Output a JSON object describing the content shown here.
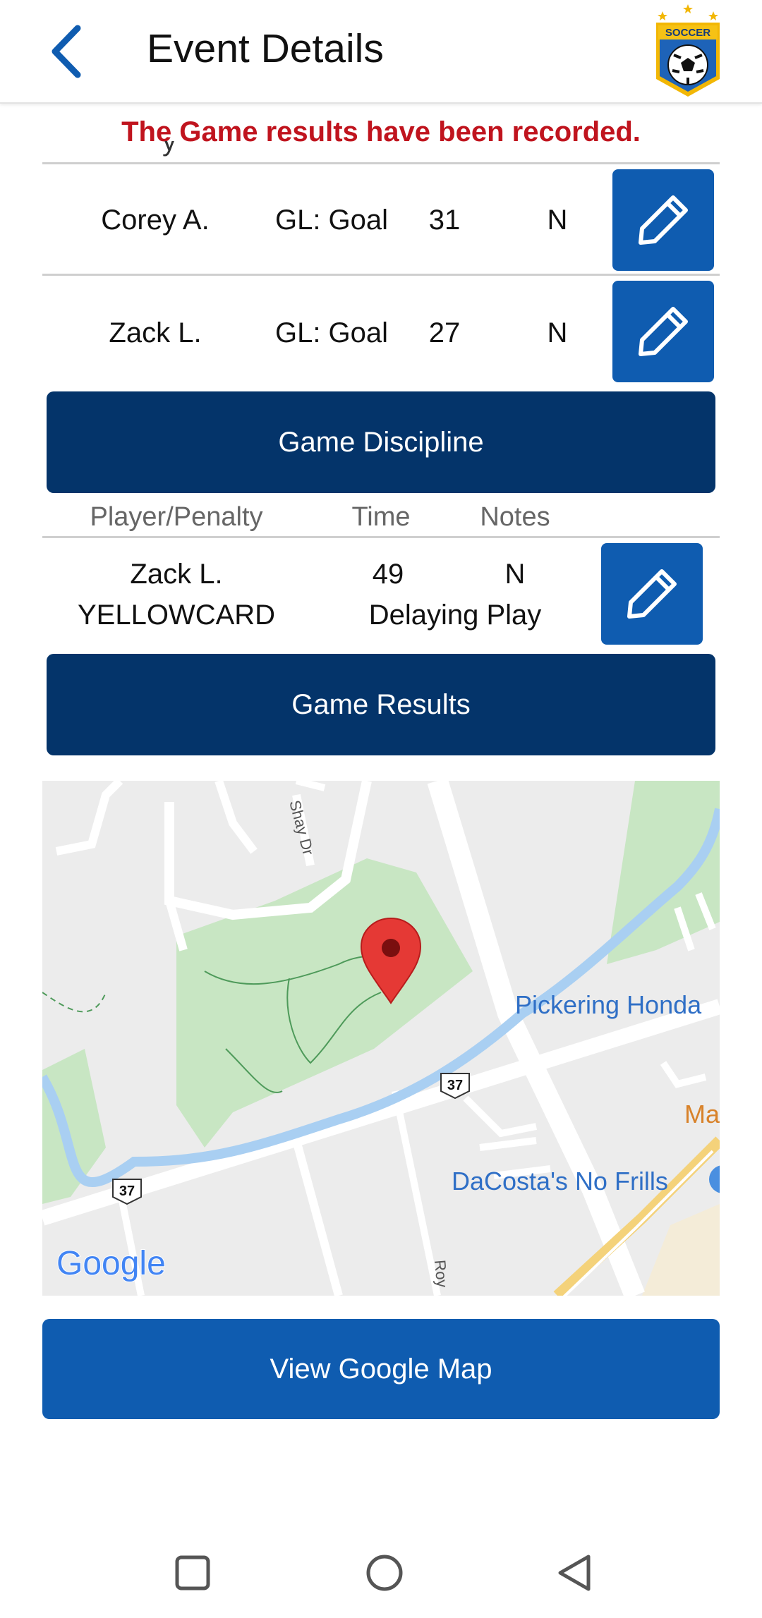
{
  "header": {
    "title": "Event Details",
    "back_icon": "chevron-left-icon",
    "logo_text": "SOCCER",
    "accent_color": "#0f5cb0"
  },
  "notice": {
    "text": "The Game results have been recorded.",
    "color": "#c0141e"
  },
  "goals": [
    {
      "player": "Corey A.",
      "type": "GL: Goal",
      "time": "31",
      "notes": "N"
    },
    {
      "player": "Zack L.",
      "type": "GL: Goal",
      "time": "27",
      "notes": "N"
    }
  ],
  "discipline": {
    "button_label": "Game Discipline",
    "headers": {
      "player_penalty": "Player/Penalty",
      "time": "Time",
      "notes": "Notes"
    },
    "rows": [
      {
        "player": "Zack L.",
        "penalty": "YELLOWCARD",
        "time": "49",
        "notes": "N",
        "reason": "Delaying Play"
      }
    ]
  },
  "results_button_label": "Game Results",
  "map": {
    "labels": {
      "street_shay": "Shay Dr",
      "street_roy": "Roy",
      "route_1": "37",
      "route_2": "37",
      "place_1": "Pickering Honda",
      "place_2": "DaCosta's No Frills",
      "place_3": "Ma",
      "attribution": "Google"
    }
  },
  "view_map_button_label": "View Google Map",
  "nav": {
    "recent_icon": "square-icon",
    "home_icon": "circle-icon",
    "back_icon": "triangle-back-icon"
  }
}
